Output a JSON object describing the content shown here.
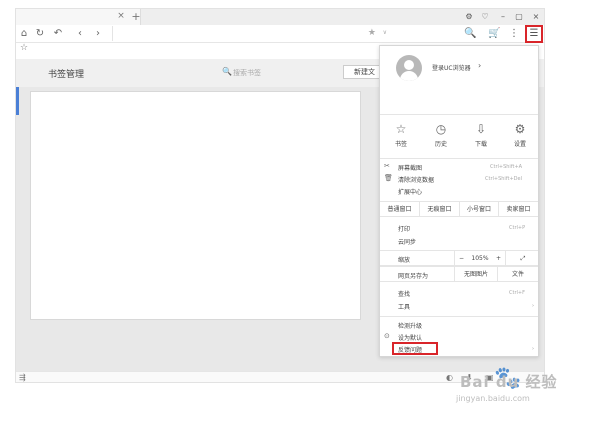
{
  "tabbar": {
    "close_glyph": "×",
    "new_tab_glyph": "+",
    "window_controls": [
      "⚙",
      "♡",
      "–",
      "▢",
      "×"
    ]
  },
  "toolbar": {
    "home": "⌂",
    "reload": "↻",
    "undo": "↶",
    "back": "‹",
    "forward": "›",
    "addr_star": "★",
    "addr_chevron": "∨",
    "search_icon": "🔍",
    "cart_icon": "🛒",
    "more_icon": "⋮",
    "menu_icon": "☰"
  },
  "bookmark_bar": {
    "star": "☆"
  },
  "page": {
    "title": "书签管理",
    "search_placeholder": "搜索书签",
    "search_glyph": "🔍",
    "new_folder_label": "新建文"
  },
  "statusbar": {
    "left_icon": "⇶",
    "right_icons": [
      "◐",
      "⬇",
      "▣"
    ]
  },
  "menu": {
    "login_text": "登录UC浏览器",
    "login_arrow": "›",
    "quick_actions": [
      {
        "icon": "☆",
        "label": "书签"
      },
      {
        "icon": "◷",
        "label": "历史"
      },
      {
        "icon": "⇩",
        "label": "下载"
      },
      {
        "icon": "⚙",
        "label": "设置"
      }
    ],
    "screenshot": {
      "icon": "✂",
      "label": "屏幕截图",
      "shortcut": "Ctrl+Shift+A"
    },
    "clear_data": {
      "icon": "🗑",
      "label": "清除浏览数据",
      "shortcut": "Ctrl+Shift+Del"
    },
    "extensions": {
      "label": "扩展中心"
    },
    "window_modes": [
      "普通窗口",
      "无痕窗口",
      "小号窗口",
      "卖家窗口"
    ],
    "print": {
      "label": "打印",
      "shortcut": "Ctrl+P"
    },
    "cloud_sync": {
      "label": "云同步"
    },
    "zoom": {
      "label": "缩放",
      "minus": "−",
      "value": "105%",
      "plus": "+",
      "fullscreen": "⤢"
    },
    "save_as": {
      "label": "网页另存为",
      "no_images": "无图图片",
      "text": "文件"
    },
    "find": {
      "label": "查找",
      "shortcut": "Ctrl+F"
    },
    "tools": {
      "label": "工具",
      "arrow": "›"
    },
    "check_updates": {
      "label": "检测升级"
    },
    "set_default": {
      "icon": "⊙",
      "label": "设为默认"
    },
    "feedback": {
      "label": "反馈问题",
      "arrow": "›"
    }
  },
  "watermark": {
    "paw": "🐾",
    "text": "Bai du 经验",
    "url": "jingyan.baidu.com"
  },
  "colors": {
    "highlight": "#d9252a",
    "accent": "#4a7fd6"
  }
}
